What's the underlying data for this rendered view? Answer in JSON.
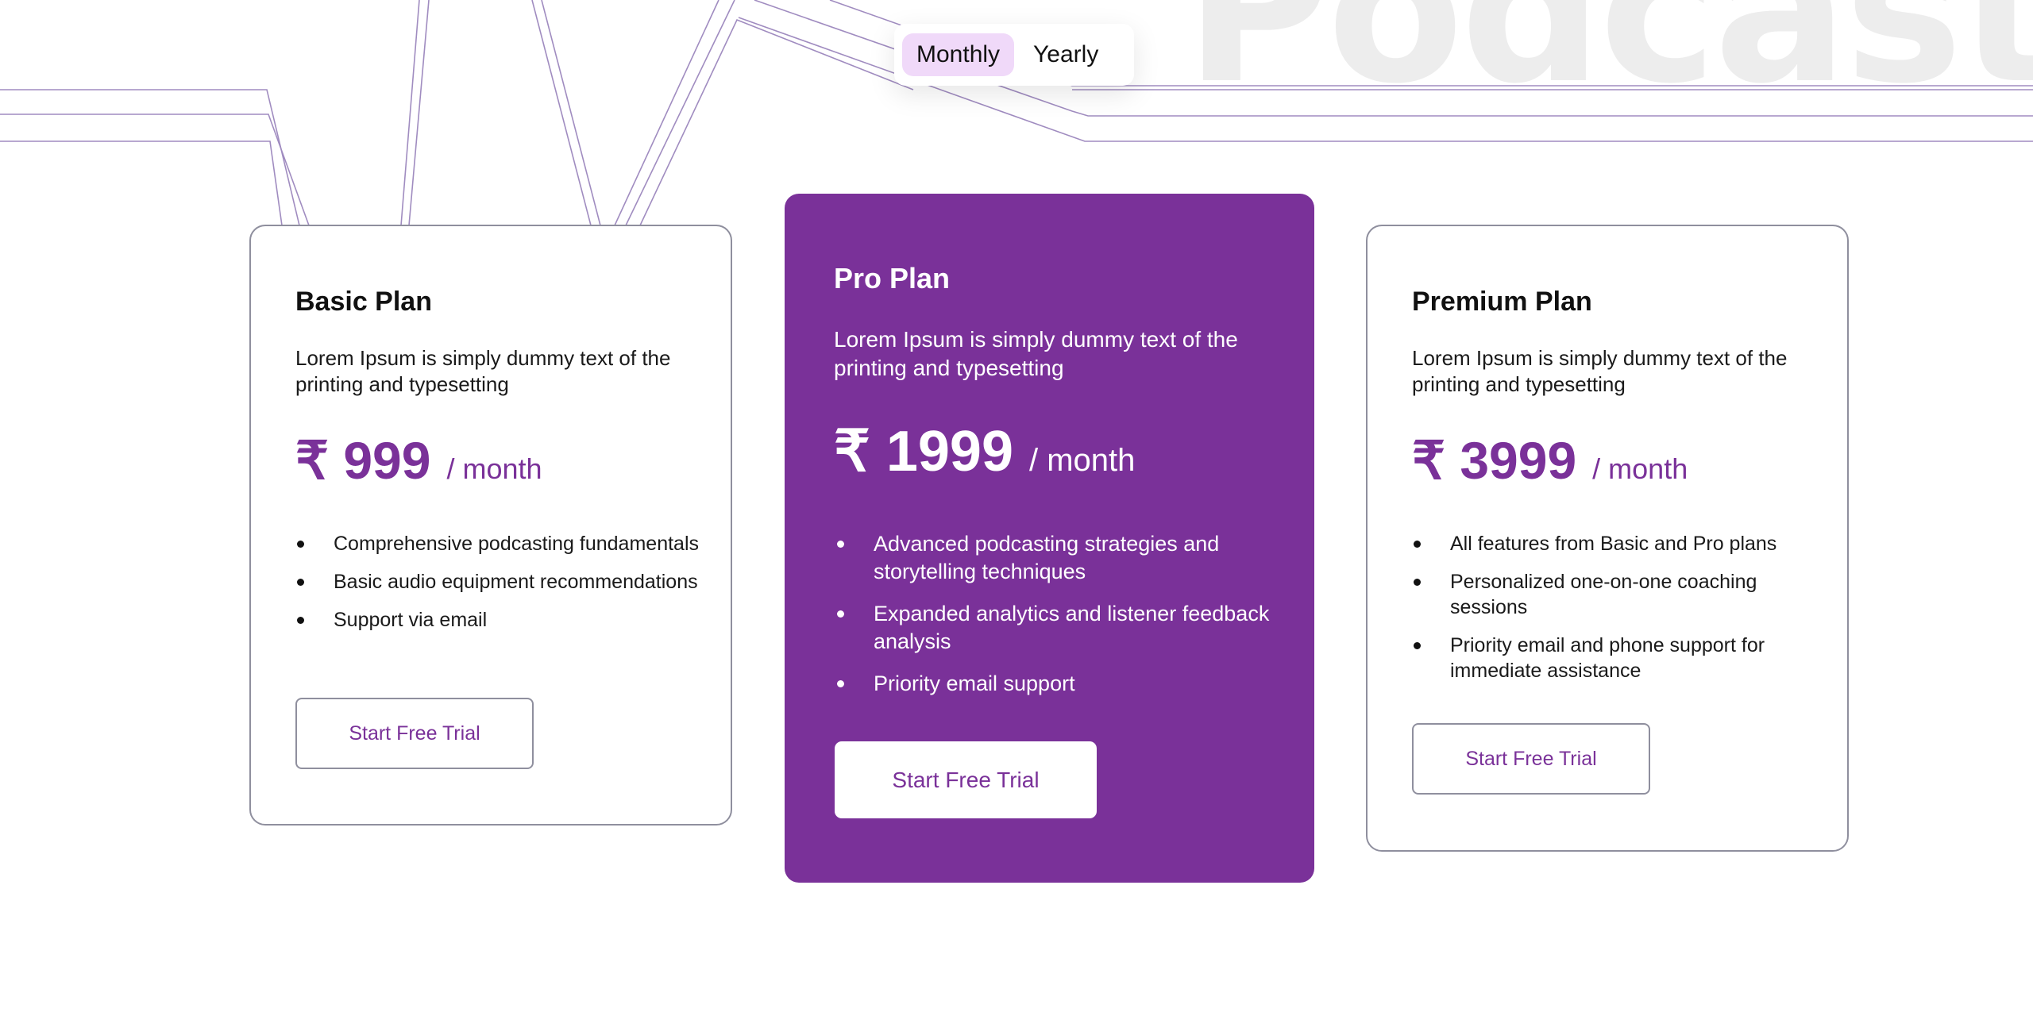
{
  "watermark": {
    "text": "Podcast"
  },
  "billing_toggle": {
    "options": [
      {
        "label": "Monthly",
        "active": true
      },
      {
        "label": "Yearly",
        "active": false
      }
    ]
  },
  "colors": {
    "accent": "#7a3199",
    "toggle_active_bg": "#f0d9f9",
    "line_color": "#a08cc0"
  },
  "plans": [
    {
      "name": "Basic Plan",
      "description": "Lorem Ipsum is simply dummy text of the printing and typesetting",
      "price": "₹ 999",
      "period": "/ month",
      "features": [
        "Comprehensive podcasting fundamentals",
        "Basic audio equipment recommendations",
        "Support via email"
      ],
      "cta": "Start Free Trial",
      "featured": false
    },
    {
      "name": "Pro Plan",
      "description": "Lorem Ipsum is simply dummy text of the printing and typesetting",
      "price": "₹ 1999",
      "period": "/ month",
      "features": [
        "Advanced podcasting strategies and storytelling techniques",
        "Expanded analytics and listener feedback analysis",
        "Priority email support"
      ],
      "cta": "Start Free Trial",
      "featured": true
    },
    {
      "name": "Premium Plan",
      "description": "Lorem Ipsum is simply dummy text of the printing and typesetting",
      "price": "₹ 3999",
      "period": "/ month",
      "features": [
        "All features from Basic and Pro plans",
        "Personalized one-on-one coaching sessions",
        "Priority email and phone support for immediate assistance"
      ],
      "cta": "Start Free Trial",
      "featured": false
    }
  ]
}
